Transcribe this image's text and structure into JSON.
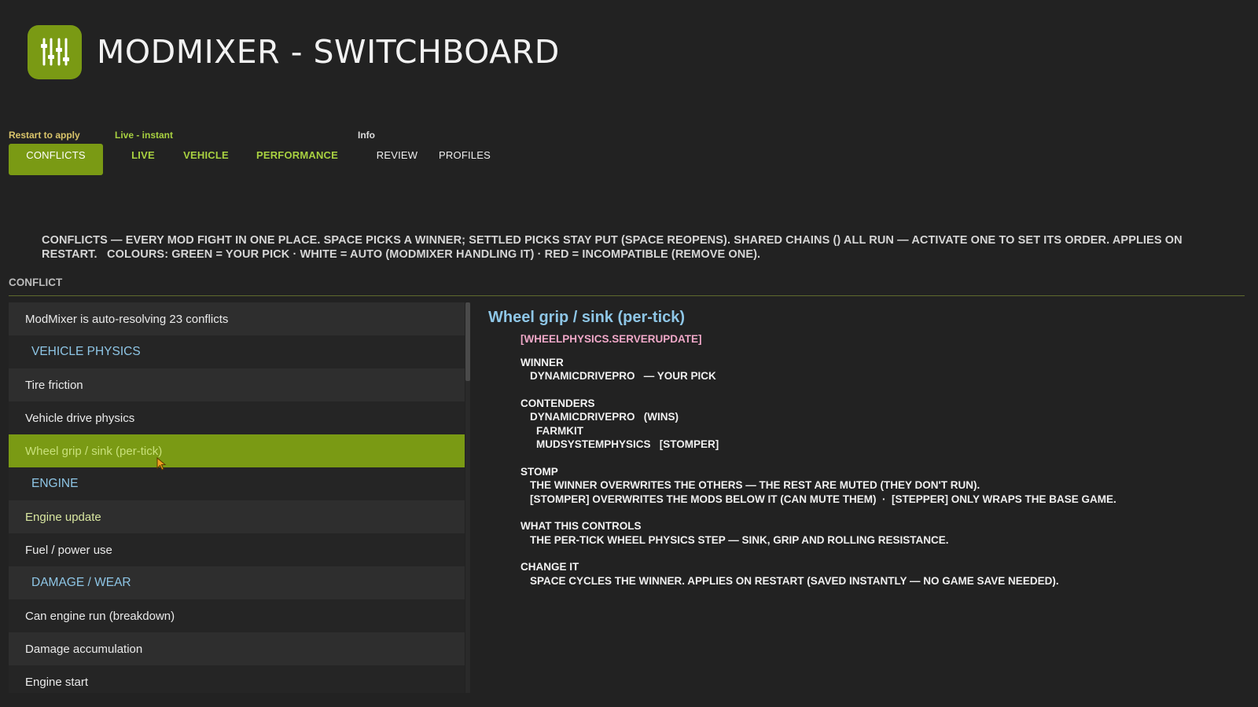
{
  "app": {
    "title": "MODMIXER - SWITCHBOARD",
    "logo_icon": "sliders-icon",
    "accent": "#7a9a14"
  },
  "tab_groups": {
    "restart": "Restart to apply",
    "live": "Live - instant",
    "info": "Info"
  },
  "tabs": {
    "conflicts": "CONFLICTS",
    "live": "LIVE",
    "vehicle": "VEHICLE",
    "performance": "PERFORMANCE",
    "review": "REVIEW",
    "profiles": "PROFILES"
  },
  "description": {
    "line1": "CONFLICTS — EVERY MOD FIGHT IN ONE PLACE. SPACE PICKS A WINNER; SETTLED PICKS STAY PUT (SPACE REOPENS). SHARED CHAINS () ALL RUN — ACTIVATE ONE TO SET ITS ORDER. APPLIES ON",
    "line2": "RESTART.   COLOURS: GREEN = YOUR PICK · WHITE = AUTO (MODMIXER HANDLING IT) · RED = INCOMPATIBLE (REMOVE ONE)."
  },
  "section_label": "CONFLICT",
  "list": {
    "items": [
      {
        "label": "ModMixer is auto-resolving 23 conflicts"
      },
      {
        "label": "VEHICLE PHYSICS"
      },
      {
        "label": "Tire friction"
      },
      {
        "label": "Vehicle drive physics"
      },
      {
        "label": "Wheel grip / sink (per-tick)"
      },
      {
        "label": "ENGINE"
      },
      {
        "label": "Engine update"
      },
      {
        "label": "Fuel / power use"
      },
      {
        "label": "DAMAGE / WEAR"
      },
      {
        "label": "Can engine run (breakdown)"
      },
      {
        "label": "Damage accumulation"
      },
      {
        "label": "Engine start"
      }
    ]
  },
  "detail": {
    "title": "Wheel grip / sink (per-tick)",
    "function_id": "[WHEELPHYSICS.SERVERUPDATE]",
    "winner": {
      "heading": "WINNER",
      "line": "DYNAMICDRIVEPRO   — YOUR PICK"
    },
    "contenders": {
      "heading": "CONTENDERS",
      "line1": "DYNAMICDRIVEPRO   (WINS)",
      "line2": "FARMKIT",
      "line3": "MUDSYSTEMPHYSICS   [STOMPER]"
    },
    "stomp": {
      "heading": "STOMP",
      "line1": "THE WINNER OVERWRITES THE OTHERS — THE REST ARE MUTED (THEY DON'T RUN).",
      "line2": "[STOMPER] OVERWRITES THE MODS BELOW IT (CAN MUTE THEM)  ·  [STEPPER] ONLY WRAPS THE BASE GAME."
    },
    "controls": {
      "heading": "WHAT THIS CONTROLS",
      "line1": "THE PER-TICK WHEEL PHYSICS STEP — SINK, GRIP AND ROLLING RESISTANCE."
    },
    "change": {
      "heading": "CHANGE IT",
      "line1": "SPACE CYCLES THE WINNER. APPLIES ON RESTART (SAVED INSTANTLY — NO GAME SAVE NEEDED)."
    }
  }
}
